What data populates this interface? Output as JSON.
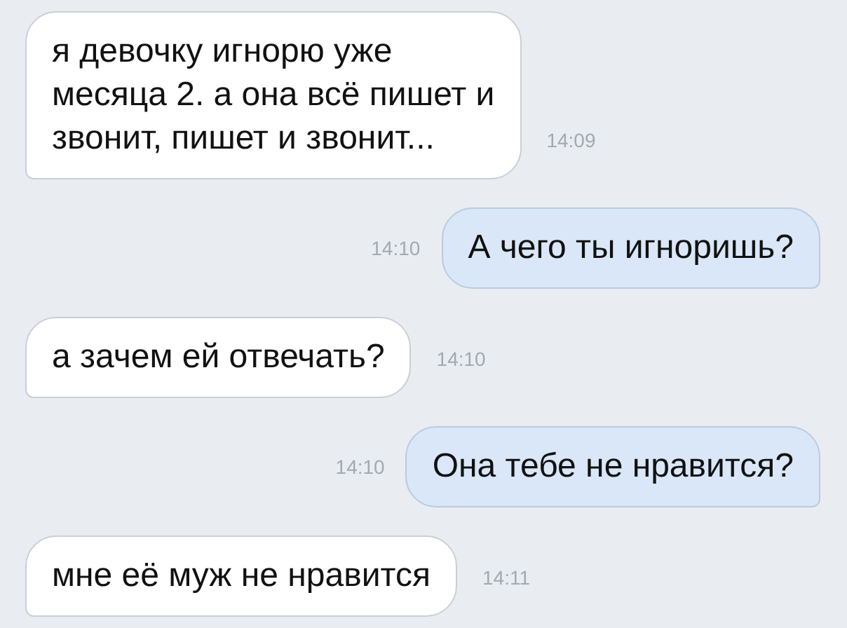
{
  "messages": [
    {
      "outgoing": false,
      "lines": [
        "я девочку игнорю уже",
        "месяца 2. а она всё пишет и",
        "звонит, пишет и звонит..."
      ],
      "time": "14:09"
    },
    {
      "outgoing": true,
      "lines": [
        "А чего ты игноришь?"
      ],
      "time": "14:10"
    },
    {
      "outgoing": false,
      "lines": [
        "а зачем ей отвечать?"
      ],
      "time": "14:10"
    },
    {
      "outgoing": true,
      "lines": [
        "Она тебе не нравится?"
      ],
      "time": "14:10"
    },
    {
      "outgoing": false,
      "lines": [
        "мне её муж не нравится"
      ],
      "time": "14:11"
    }
  ]
}
